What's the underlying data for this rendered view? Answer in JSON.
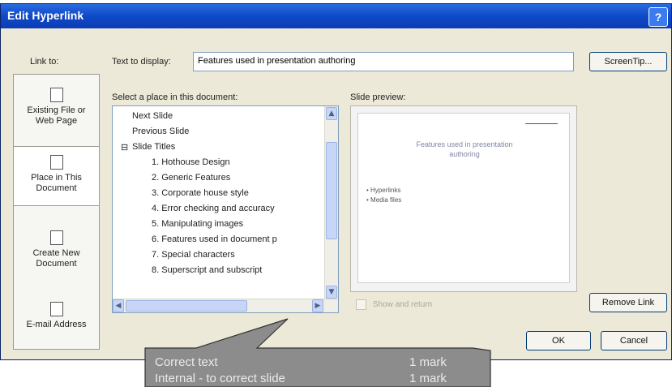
{
  "window": {
    "title": "Edit Hyperlink",
    "help_label": "?"
  },
  "link_to_label": "Link to:",
  "text_to_display": {
    "label": "Text to display:",
    "value": "Features used in presentation authoring"
  },
  "buttons": {
    "screentip": "ScreenTip...",
    "remove_link": "Remove Link",
    "ok": "OK",
    "cancel": "Cancel"
  },
  "link_types": [
    {
      "label_line1": "Existing File or",
      "label_line2": "Web Page"
    },
    {
      "label_line1": "Place in This",
      "label_line2": "Document"
    },
    {
      "label_line1": "Create New",
      "label_line2": "Document"
    },
    {
      "label_line1": "E-mail Address",
      "label_line2": ""
    }
  ],
  "select_place_label": "Select a place in this document:",
  "tree": {
    "items": [
      "Next Slide",
      "Previous Slide"
    ],
    "group_label": "Slide Titles",
    "group_toggle": "⊟",
    "slides": [
      "1. Hothouse Design",
      "2. Generic Features",
      "3. Corporate house style",
      "4. Error checking and accuracy",
      "5. Manipulating images",
      "6. Features used in document p",
      "7. Special characters",
      "8. Superscript and subscript"
    ]
  },
  "slide_preview": {
    "label": "Slide preview:",
    "title_line1": "Features used in presentation",
    "title_line2": "authoring",
    "bullets": [
      "Hyperlinks",
      "Media files"
    ]
  },
  "show_all_label": "Show and return",
  "callout": {
    "rows": [
      {
        "label": "Correct text",
        "marks": "1 mark"
      },
      {
        "label": "Internal - to correct slide",
        "marks": "1 mark"
      }
    ]
  }
}
